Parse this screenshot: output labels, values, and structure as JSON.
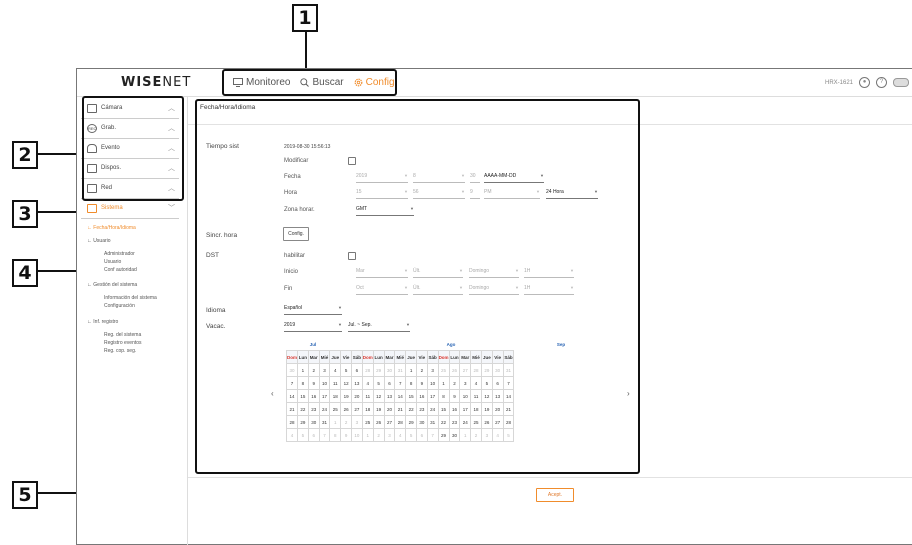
{
  "callouts": [
    "1",
    "2",
    "3",
    "4",
    "5"
  ],
  "app": {
    "logo_bold": "WISE",
    "logo_rest": "NET",
    "device": "HRX-1621"
  },
  "topnav": [
    {
      "label": "Monitoreo",
      "icon": "monitor-icon"
    },
    {
      "label": "Buscar",
      "icon": "search-icon"
    },
    {
      "label": "Config.",
      "icon": "gear-icon"
    }
  ],
  "sidebar": {
    "items": [
      {
        "label": "Cámara",
        "icon": "camera-icon"
      },
      {
        "label": "Grab.",
        "icon": "record-icon",
        "glyph": "REC"
      },
      {
        "label": "Evento",
        "icon": "bell-icon"
      },
      {
        "label": "Dispos.",
        "icon": "device-icon"
      },
      {
        "label": "Red",
        "icon": "network-icon"
      },
      {
        "label": "Sistema",
        "icon": "system-icon"
      }
    ],
    "sub": [
      "Fecha/Hora/Idioma",
      "Usuario",
      "Administrador",
      "Usuario",
      "Conf autoridad",
      "Gestión del sistema",
      "Información del sistema",
      "Configuración",
      "Inf. registro",
      "Reg. del sistema",
      "Registro eventos",
      "Reg. cop. seg."
    ]
  },
  "main": {
    "title": "Fecha/Hora/Idioma",
    "tiempo_sist": "Tiempo sist",
    "datetime": "2019-08-30 15:56:13",
    "modificar": "Modificar",
    "fecha": "Fecha",
    "fecha_vals": [
      "2019",
      "8",
      "30",
      "AAAA-MM-DD"
    ],
    "hora": "Hora",
    "hora_vals": [
      "15",
      "56",
      "9",
      "PM",
      "24 Hora"
    ],
    "zona": "Zona horar.",
    "zona_val": "GMT",
    "sincr": "Sincr. hora",
    "config_btn": "Config.",
    "dst": "DST",
    "habilitar": "habilitar",
    "inicio": "Inicio",
    "inicio_vals": [
      "Mar",
      "Últ.",
      "Domingo",
      "1H"
    ],
    "fin": "Fin",
    "fin_vals": [
      "Oct",
      "Últ.",
      "Domingo",
      "1H"
    ],
    "idioma": "Idioma",
    "idioma_val": "Español",
    "vacac": "Vacac.",
    "vacac_year": "2019",
    "vacac_range": "Jul. ~ Sep.",
    "accept": "Acept."
  },
  "calendar": {
    "months": [
      "Jul",
      "Ago",
      "Sep"
    ],
    "weekdays": [
      "Dom",
      "Lun",
      "Mar",
      "Mié",
      "Jue",
      "Vie",
      "Sáb"
    ],
    "grids": [
      [
        [
          "30",
          "1",
          "2",
          "3",
          "4",
          "5",
          "6"
        ],
        [
          "7",
          "8",
          "9",
          "10",
          "11",
          "12",
          "13"
        ],
        [
          "14",
          "15",
          "16",
          "17",
          "18",
          "19",
          "20"
        ],
        [
          "21",
          "22",
          "23",
          "24",
          "25",
          "26",
          "27"
        ],
        [
          "28",
          "29",
          "30",
          "31",
          "1",
          "2",
          "3"
        ],
        [
          "4",
          "5",
          "6",
          "7",
          "8",
          "9",
          "10"
        ]
      ],
      [
        [
          "28",
          "29",
          "30",
          "31",
          "1",
          "2",
          "3"
        ],
        [
          "4",
          "5",
          "6",
          "7",
          "8",
          "9",
          "10"
        ],
        [
          "11",
          "12",
          "13",
          "14",
          "15",
          "16",
          "17"
        ],
        [
          "18",
          "19",
          "20",
          "21",
          "22",
          "23",
          "24"
        ],
        [
          "25",
          "26",
          "27",
          "28",
          "29",
          "30",
          "31"
        ],
        [
          "1",
          "2",
          "3",
          "4",
          "5",
          "6",
          "7"
        ]
      ],
      [
        [
          "25",
          "26",
          "27",
          "28",
          "29",
          "30",
          "31"
        ],
        [
          "1",
          "2",
          "3",
          "4",
          "5",
          "6",
          "7"
        ],
        [
          "8",
          "9",
          "10",
          "11",
          "12",
          "13",
          "14"
        ],
        [
          "15",
          "16",
          "17",
          "18",
          "19",
          "20",
          "21"
        ],
        [
          "22",
          "23",
          "24",
          "25",
          "26",
          "27",
          "28"
        ],
        [
          "29",
          "30",
          "1",
          "2",
          "3",
          "4",
          "5"
        ]
      ]
    ],
    "dim_ranges": [
      [
        [
          0,
          0,
          0
        ],
        [
          4,
          4,
          6
        ],
        [
          5,
          0,
          6
        ]
      ],
      [
        [
          0,
          0,
          3
        ],
        [
          5,
          0,
          6
        ]
      ],
      [
        [
          0,
          0,
          6
        ],
        [
          5,
          2,
          6
        ]
      ]
    ]
  },
  "colors": {
    "accent": "#f08c2c",
    "month": "#2864b4",
    "sunday": "#d9342b"
  }
}
